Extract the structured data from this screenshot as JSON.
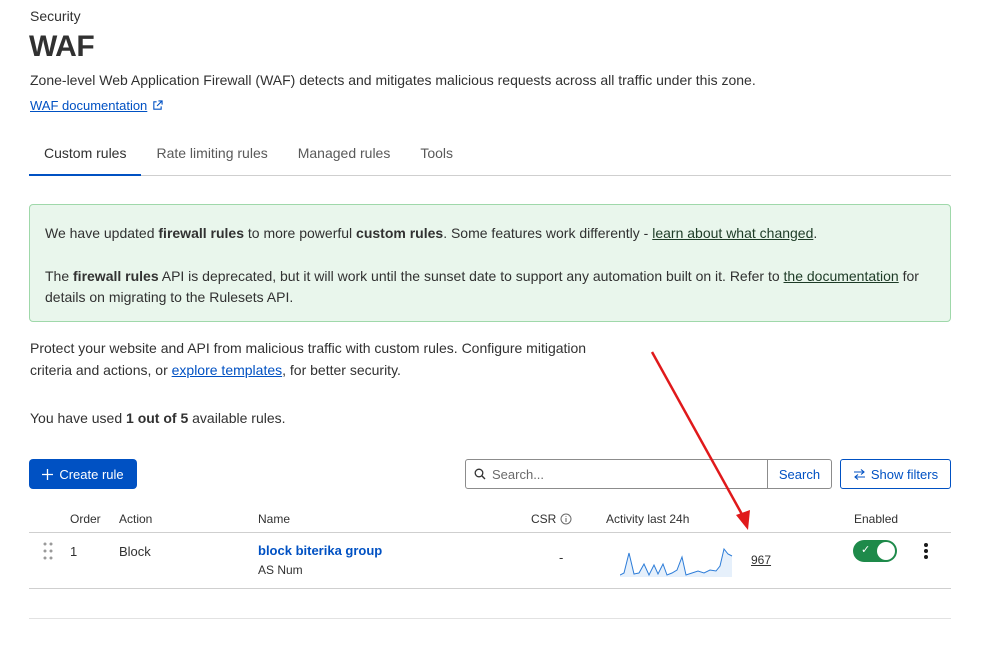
{
  "breadcrumb": "Security",
  "page_title": "WAF",
  "description": "Zone-level Web Application Firewall (WAF) detects and mitigates malicious requests across all traffic under this zone.",
  "doc_link": "WAF documentation",
  "icons": {
    "external": "external-link-icon",
    "plus": "plus-icon",
    "search": "search-icon",
    "filters": "arrows-swap-icon",
    "info": "info-icon",
    "drag": "drag-handle-icon",
    "more": "kebab-menu-icon",
    "check": "check-icon"
  },
  "tabs": [
    {
      "label": "Custom rules",
      "active": true
    },
    {
      "label": "Rate limiting rules",
      "active": false
    },
    {
      "label": "Managed rules",
      "active": false
    },
    {
      "label": "Tools",
      "active": false
    }
  ],
  "notice": {
    "p1_a": "We have updated ",
    "p1_b": "firewall rules",
    "p1_c": " to more powerful ",
    "p1_d": "custom rules",
    "p1_e": ". Some features work differently - ",
    "p1_link": "learn about what changed",
    "p1_f": ".",
    "p2_a": "The ",
    "p2_b": "firewall rules",
    "p2_c": " API is deprecated, but it will work until the sunset date to support any automation built on it. Refer to ",
    "p2_link": "the documentation",
    "p2_d": " for details on migrating to the Rulesets API."
  },
  "intro": {
    "text_a": "Protect your website and API from malicious traffic with custom rules. Configure mitigation criteria and actions, or ",
    "link": "explore templates",
    "text_b": ", for better security."
  },
  "usage": {
    "prefix": "You have used ",
    "bold": "1 out of 5",
    "suffix": " available rules."
  },
  "toolbar": {
    "create_label": "Create rule",
    "search_placeholder": "Search...",
    "search_button": "Search",
    "filters_label": "Show filters"
  },
  "table": {
    "headers": {
      "order": "Order",
      "action": "Action",
      "name": "Name",
      "csr": "CSR",
      "activity": "Activity last 24h",
      "enabled": "Enabled"
    },
    "rows": [
      {
        "order": "1",
        "action": "Block",
        "name": "block biterika group",
        "sub": "AS Num",
        "csr": "-",
        "activity_count": "967",
        "enabled": true
      }
    ]
  },
  "colors": {
    "accent": "#0051c3",
    "success_bg": "#e9f6ec",
    "toggle_on": "#1e8a4a",
    "annotation_arrow": "#e0191b"
  }
}
